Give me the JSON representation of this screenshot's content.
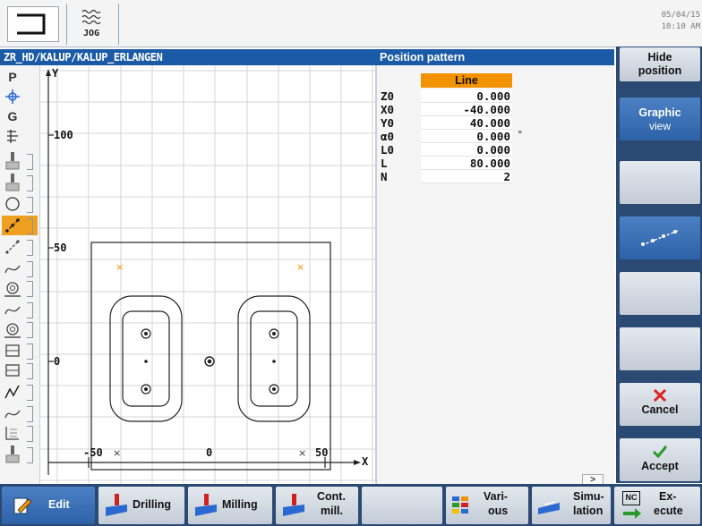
{
  "topbar": {
    "mode_label": "JOG",
    "date": "05/04/15",
    "time": "10:10 AM"
  },
  "header": {
    "path": "ZR_HD/KALUP/KALUP_ERLANGEN",
    "panel_title": "Position pattern"
  },
  "graphic": {
    "axis_y": "Y",
    "axis_x": "X",
    "tick_100": "100",
    "tick_50": "50",
    "tick_0": "0",
    "xtick_m50": "-50",
    "xtick_0": "0",
    "xtick_50": "50",
    "x_mark": "×"
  },
  "left_toolbar": {
    "p_label": "P",
    "g_label": "G"
  },
  "params": {
    "selector": "Line",
    "rows": [
      {
        "label": "Z0",
        "value": "0.000",
        "unit": ""
      },
      {
        "label": "X0",
        "value": "-40.000",
        "unit": ""
      },
      {
        "label": "Y0",
        "value": "40.000",
        "unit": ""
      },
      {
        "label": "α0",
        "value": "0.000",
        "unit": "°"
      },
      {
        "label": "L0",
        "value": "0.000",
        "unit": ""
      },
      {
        "label": "L",
        "value": "80.000",
        "unit": ""
      },
      {
        "label": "N",
        "value": "2",
        "unit": ""
      }
    ],
    "scroll_glyph": ">"
  },
  "right_softkeys": {
    "hide_line1": "Hide",
    "hide_line2": "position",
    "graphic_line1": "Graphic",
    "graphic_line2": "view",
    "cancel": "Cancel",
    "accept": "Accept"
  },
  "bottom_softkeys": {
    "edit": "Edit",
    "drilling": "Drilling",
    "milling": "Milling",
    "cont_line1": "Cont.",
    "cont_line2": "mill.",
    "various_line1": "Vari-",
    "various_line2": "ous",
    "sim_line1": "Simu-",
    "sim_line2": "lation",
    "nc_badge": "NC",
    "exec_line1": "Ex-",
    "exec_line2": "ecute"
  },
  "colors": {
    "accent_orange": "#f39200",
    "header_blue": "#1a5aa6",
    "softkey_panel": "#2a4a74",
    "cancel_red": "#e02020",
    "accept_green": "#2a9a2a"
  }
}
